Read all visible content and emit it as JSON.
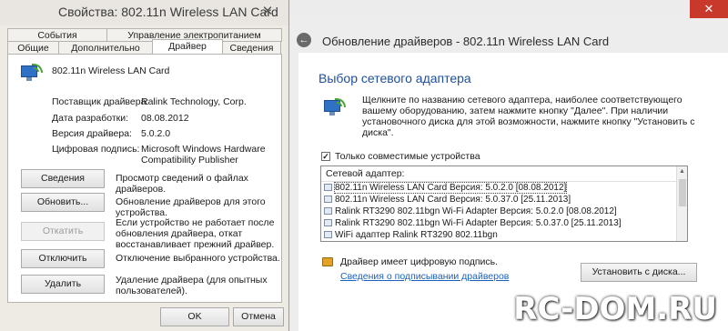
{
  "properties": {
    "title": "Свойства: 802.11n Wireless LAN Card",
    "tabs_row1": [
      "События",
      "Управление электропитанием"
    ],
    "tabs_row2": [
      "Общие",
      "Дополнительно",
      "Драйвер",
      "Сведения"
    ],
    "device_name": "802.11n Wireless LAN Card",
    "info": {
      "vendor_label": "Поставщик драйвера:",
      "vendor_value": "Ralink Technology, Corp.",
      "date_label": "Дата разработки:",
      "date_value": "08.08.2012",
      "version_label": "Версия драйвера:",
      "version_value": "5.0.2.0",
      "signer_label": "Цифровая подпись:",
      "signer_value_line1": "Microsoft Windows Hardware",
      "signer_value_line2": "Compatibility Publisher"
    },
    "buttons": [
      {
        "label": "Сведения",
        "desc": "Просмотр сведений о файлах драйверов."
      },
      {
        "label": "Обновить...",
        "desc": "Обновление драйверов для этого устройства."
      },
      {
        "label": "Откатить",
        "desc": "Если устройство не работает после обновления драйвера, откат восстанавливает прежний драйвер."
      },
      {
        "label": "Отключить",
        "desc": "Отключение выбранного устройства."
      },
      {
        "label": "Удалить",
        "desc": "Удаление драйвера (для опытных пользователей)."
      }
    ],
    "ok_label": "OK",
    "cancel_label": "Отмена"
  },
  "wizard": {
    "header_title": "Обновление драйверов - 802.11n Wireless LAN Card",
    "section_title": "Выбор сетевого адаптера",
    "description": "Щелкните по названию сетевого адаптера, наиболее соответствующего вашему оборудованию, затем нажмите кнопку \"Далее\". При наличии установочного диска для этой возможности, нажмите кнопку \"Установить с диска\".",
    "compatible_label": "Только совместимые устройства",
    "compatible_checked": true,
    "list_header": "Сетевой адаптер:",
    "list_items": [
      "802.11n Wireless LAN Card Версия: 5.0.2.0 [08.08.2012]",
      "802.11n Wireless LAN Card Версия: 5.0.37.0 [25.11.2013]",
      "Ralink RT3290 802.11bgn Wi-Fi Adapter Версия: 5.0.2.0 [08.08.2012]",
      "Ralink RT3290 802.11bgn Wi-Fi Adapter Версия: 5.0.37.0 [25.11.2013]",
      "WiFi адаптер Ralink RT3290 802.11bgn"
    ],
    "signed_text": "Драйвер имеет цифровую подпись.",
    "signing_link": "Сведения о подписывании драйверов",
    "install_disk_label": "Установить с диска..."
  },
  "watermark": "RC-DOM.RU"
}
